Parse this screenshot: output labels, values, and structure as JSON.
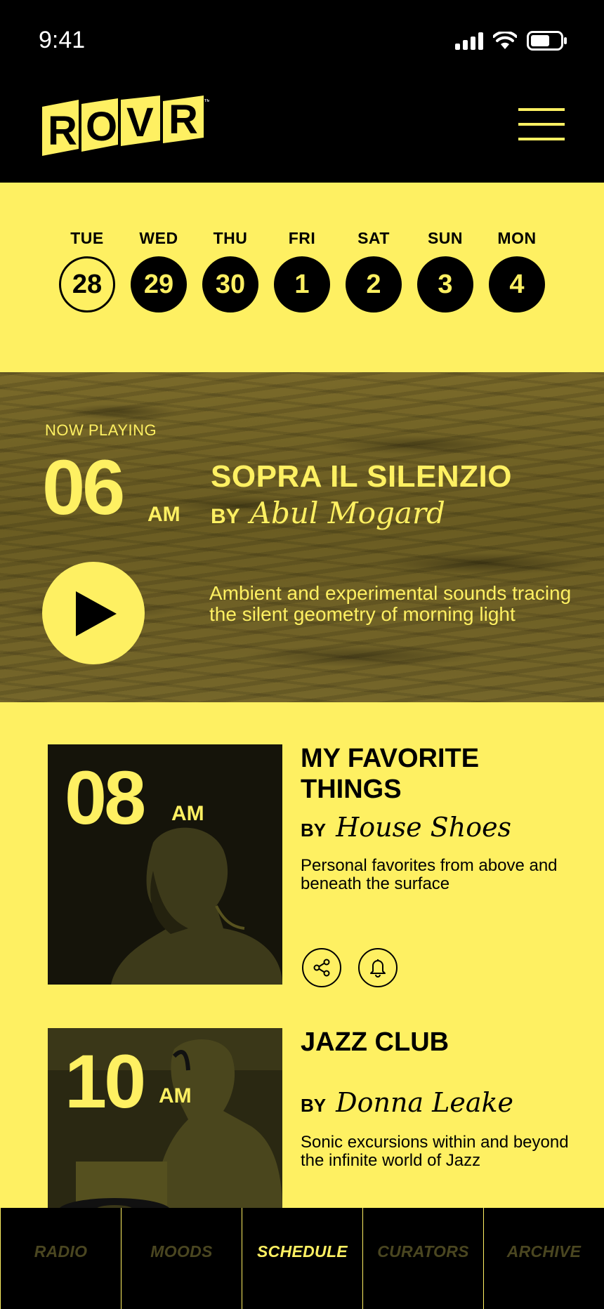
{
  "status_bar": {
    "time": "9:41"
  },
  "header": {
    "logo_text": "ROVR",
    "trademark": "™"
  },
  "days": [
    {
      "name": "TUE",
      "num": "28",
      "active": true
    },
    {
      "name": "WED",
      "num": "29"
    },
    {
      "name": "THU",
      "num": "30"
    },
    {
      "name": "FRI",
      "num": "1"
    },
    {
      "name": "SAT",
      "num": "2"
    },
    {
      "name": "SUN",
      "num": "3"
    },
    {
      "name": "MON",
      "num": "4"
    }
  ],
  "now_playing": {
    "label": "NOW PLAYING",
    "hour": "06",
    "ampm": "AM",
    "title": "SOPRA IL SILENZIO",
    "by": "BY",
    "artist": "Abul Mogard",
    "description": "Ambient and experimental sounds tracing the silent geometry of morning light"
  },
  "shows": [
    {
      "hour": "08",
      "ampm": "AM",
      "title": "MY FAVORITE THINGS",
      "by": "BY",
      "artist": "House Shoes",
      "description": "Personal favorites from above and beneath the surface"
    },
    {
      "hour": "10",
      "ampm": "AM",
      "title": "JAZZ CLUB",
      "by": "BY",
      "artist": "Donna Leake",
      "description": "Sonic excursions within and beyond the infinite world of Jazz"
    }
  ],
  "nav": [
    {
      "label": "RADIO"
    },
    {
      "label": "MOODS"
    },
    {
      "label": "SCHEDULE",
      "active": true
    },
    {
      "label": "CURATORS"
    },
    {
      "label": "ARCHIVE"
    }
  ],
  "colors": {
    "accent": "#fef062",
    "background": "#000000"
  }
}
